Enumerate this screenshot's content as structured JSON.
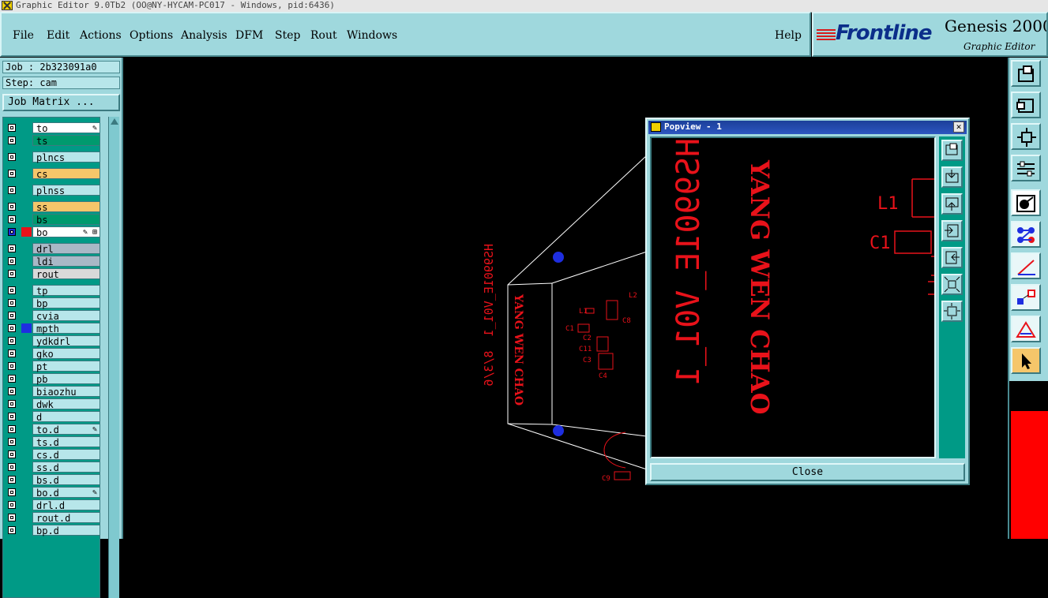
{
  "window": {
    "title": "Graphic Editor 9.0Tb2 (OO@NY-HYCAM-PC017 - Windows, pid:6436)"
  },
  "menu": [
    "File",
    "Edit",
    "Actions",
    "Options",
    "Analysis",
    "DFM",
    "Step",
    "Rout",
    "Windows"
  ],
  "help_label": "Help",
  "logo": {
    "brand": "Frontline",
    "product": "Genesis 2000",
    "subtitle": "Graphic Editor"
  },
  "job": {
    "job_label": "Job : 2b323091a0",
    "step_label": "Step: cam",
    "matrix_button": "Job Matrix ..."
  },
  "layers": [
    {
      "name": "to",
      "color": "#ffffff",
      "flag": "✎"
    },
    {
      "name": "ts",
      "color": "#009a6e"
    },
    {
      "name": "plncs",
      "color": "#b7e6ea"
    },
    {
      "name": "cs",
      "color": "#f5c66a"
    },
    {
      "name": "plnss",
      "color": "#b7e6ea"
    },
    {
      "name": "ss",
      "color": "#f5c66a"
    },
    {
      "name": "bs",
      "color": "#009a6e"
    },
    {
      "name": "bo",
      "color": "#ffffff",
      "flag": "✎ ⊞",
      "work": true,
      "swatch": "#e8121a"
    },
    {
      "name": "drl",
      "color": "#a9b8c6"
    },
    {
      "name": "ldi",
      "color": "#a9b8c6"
    },
    {
      "name": "rout",
      "color": "#d9d9d9"
    },
    {
      "name": "tp",
      "color": "#b7e6ea"
    },
    {
      "name": "bp",
      "color": "#b7e6ea"
    },
    {
      "name": "cvia",
      "color": "#b7e6ea"
    },
    {
      "name": "mpth",
      "color": "#b7e6ea",
      "swatch": "#1e2ee0"
    },
    {
      "name": "ydkdrl",
      "color": "#b7e6ea"
    },
    {
      "name": "gko",
      "color": "#b7e6ea"
    },
    {
      "name": "pt",
      "color": "#b7e6ea"
    },
    {
      "name": "pb",
      "color": "#b7e6ea"
    },
    {
      "name": "biaozhu",
      "color": "#b7e6ea"
    },
    {
      "name": "dwk",
      "color": "#b7e6ea"
    },
    {
      "name": "d",
      "color": "#b7e6ea"
    },
    {
      "name": "to.d",
      "color": "#b7e6ea",
      "flag": "✎"
    },
    {
      "name": "ts.d",
      "color": "#b7e6ea"
    },
    {
      "name": "cs.d",
      "color": "#b7e6ea"
    },
    {
      "name": "ss.d",
      "color": "#b7e6ea"
    },
    {
      "name": "bs.d",
      "color": "#b7e6ea"
    },
    {
      "name": "bo.d",
      "color": "#b7e6ea",
      "flag": "✎"
    },
    {
      "name": "drl.d",
      "color": "#b7e6ea"
    },
    {
      "name": "rout.d",
      "color": "#b7e6ea"
    },
    {
      "name": "bp.d",
      "color": "#b7e6ea"
    }
  ],
  "board_text": {
    "line1": "YANG WEN CHAO",
    "line2": "HS9901E_V01_1",
    "line2_main": "HS9901E_V01_1  8/3/6",
    "refs_main": [
      "L1",
      "C1",
      "C2",
      "C11",
      "C3",
      "C4",
      "C9",
      "C8",
      "L2"
    ]
  },
  "popview": {
    "title": "Popview - 1",
    "close_label": "Close",
    "close_x": "✕"
  }
}
